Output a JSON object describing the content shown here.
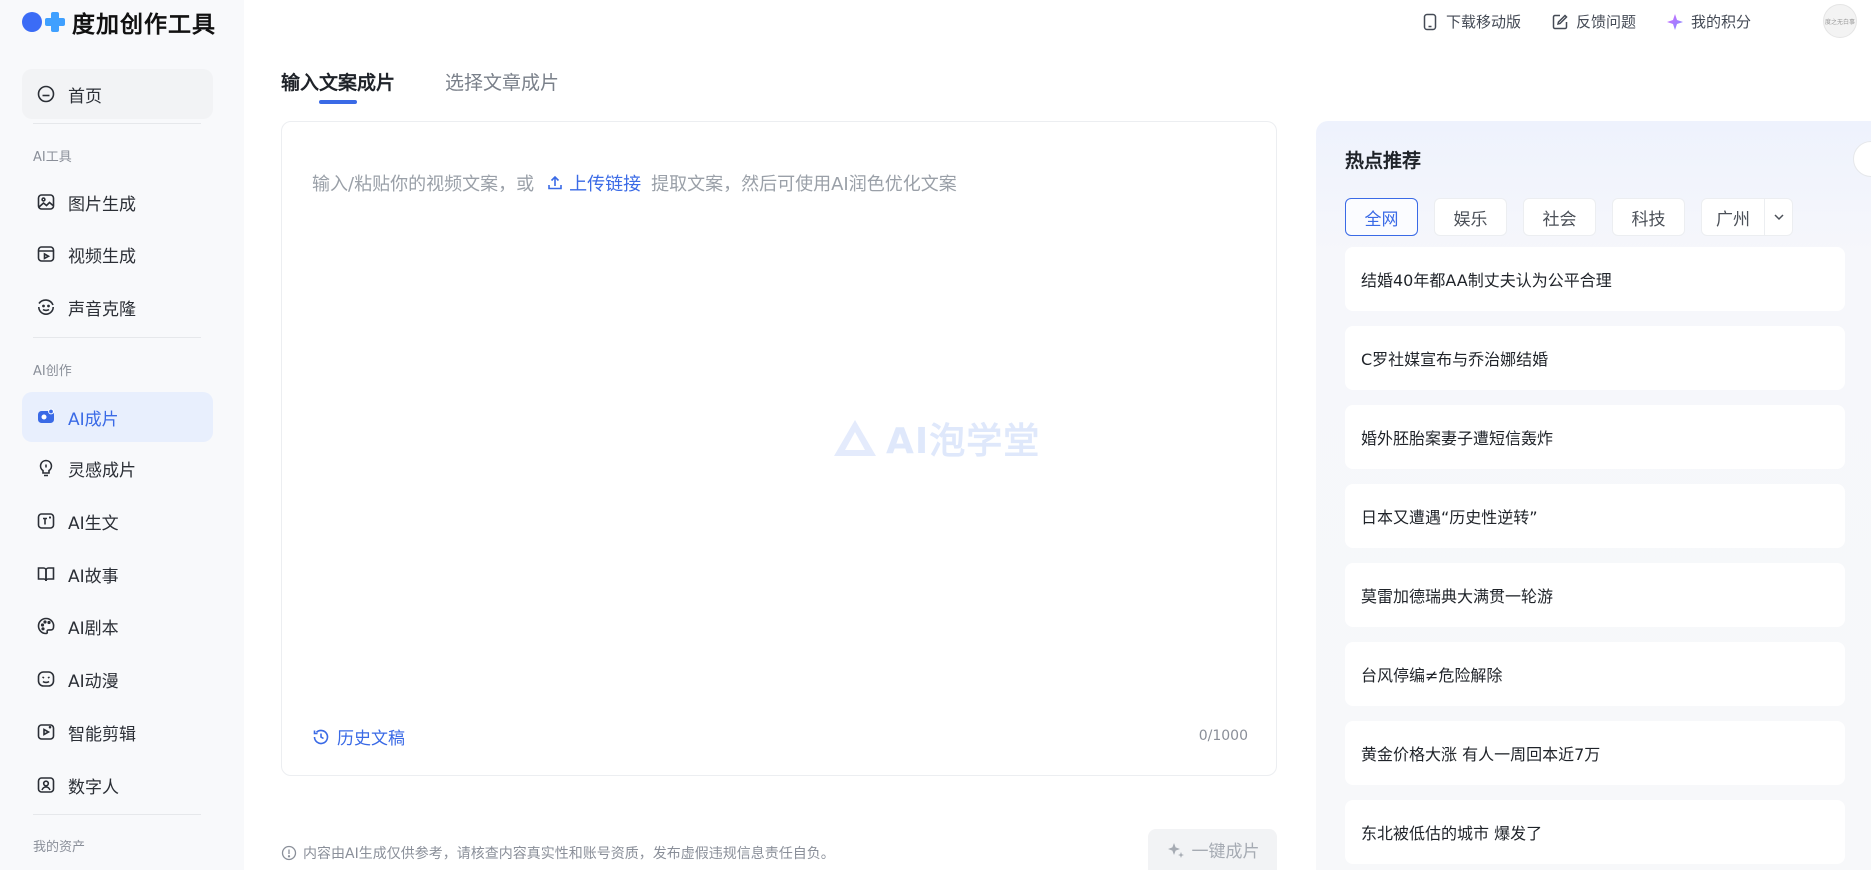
{
  "app": {
    "logo_text": "度加创作工具"
  },
  "header": {
    "download_label": "下载移动版",
    "feedback_label": "反馈问题",
    "points_label": "我的积分",
    "avatar_text": "度之无白事"
  },
  "sidebar": {
    "home": "首页",
    "section_tools": "AI工具",
    "tools": [
      "图片生成",
      "视频生成",
      "声音克隆"
    ],
    "section_create": "AI创作",
    "create": [
      "AI成片",
      "灵感成片",
      "AI生文",
      "AI故事",
      "AI剧本",
      "AI动漫",
      "智能剪辑",
      "数字人"
    ],
    "section_assets": "我的资产"
  },
  "tabs": [
    "输入文案成片",
    "选择文章成片"
  ],
  "editor": {
    "placeholder_prefix": "输入/粘贴你的视频文案，或",
    "upload_link": "上传链接",
    "placeholder_suffix": "提取文案，然后可使用AI润色优化文案",
    "watermark": "AI泡学堂",
    "history_label": "历史文稿",
    "counter": "0/1000"
  },
  "footer": {
    "disclaimer": "内容由AI生成仅供参考，请核查内容真实性和账号资质，发布虚假违规信息责任自负。",
    "one_click": "一键成片"
  },
  "hot": {
    "title": "热点推荐",
    "chips": [
      "全网",
      "娱乐",
      "社会",
      "科技"
    ],
    "city": "广州",
    "items": [
      "结婚40年都AA制丈夫认为公平合理",
      "C罗社媒宣布与乔治娜结婚",
      "婚外胚胎案妻子遭短信轰炸",
      "日本又遭遇“历史性逆转”",
      "莫雷加德瑞典大满贯一轮游",
      "台风停编≠危险解除",
      "黄金价格大涨 有人一周回本近7万",
      "东北被低估的城市 爆发了"
    ]
  },
  "colors": {
    "accent": "#3a6ae6",
    "sidebar_bg": "#f8f9fb",
    "active_bg": "#e8effd"
  }
}
